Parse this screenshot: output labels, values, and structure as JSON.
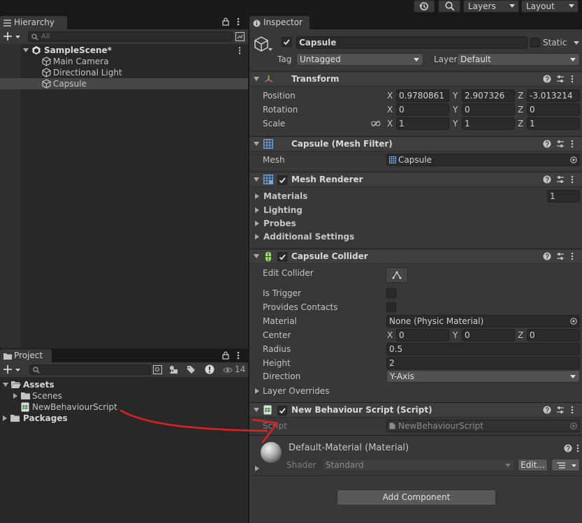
{
  "toolbar": {
    "layers_label": "Layers",
    "layout_label": "Layout"
  },
  "hierarchy": {
    "tab_label": "Hierarchy",
    "search_placeholder": "All",
    "scene_name": "SampleScene*",
    "items": [
      {
        "label": "Main Camera"
      },
      {
        "label": "Directional Light"
      },
      {
        "label": "Capsule"
      }
    ]
  },
  "project": {
    "tab_label": "Project",
    "hidden_count": "14",
    "tree": {
      "assets": "Assets",
      "scenes": "Scenes",
      "script": "NewBehaviourScript",
      "packages": "Packages"
    }
  },
  "inspector": {
    "tab_label": "Inspector",
    "object_name": "Capsule",
    "static_label": "Static",
    "tag_label": "Tag",
    "tag_value": "Untagged",
    "layer_label": "Layer",
    "layer_value": "Default",
    "transform": {
      "title": "Transform",
      "position_label": "Position",
      "rotation_label": "Rotation",
      "scale_label": "Scale",
      "axis_x": "X",
      "axis_y": "Y",
      "axis_z": "Z",
      "position": {
        "x": "0.9780861",
        "y": "2.907326",
        "z": "-3.013214"
      },
      "rotation": {
        "x": "0",
        "y": "0",
        "z": "0"
      },
      "scale": {
        "x": "1",
        "y": "1",
        "z": "1"
      }
    },
    "mesh_filter": {
      "title": "Capsule (Mesh Filter)",
      "mesh_label": "Mesh",
      "mesh_value": "Capsule"
    },
    "mesh_renderer": {
      "title": "Mesh Renderer",
      "materials_label": "Materials",
      "materials_count": "1",
      "lighting_label": "Lighting",
      "probes_label": "Probes",
      "additional_label": "Additional Settings"
    },
    "capsule_collider": {
      "title": "Capsule Collider",
      "edit_collider_label": "Edit Collider",
      "is_trigger_label": "Is Trigger",
      "provides_contacts_label": "Provides Contacts",
      "material_label": "Material",
      "material_value": "None (Physic Material)",
      "center_label": "Center",
      "center": {
        "x": "0",
        "y": "0",
        "z": "0"
      },
      "radius_label": "Radius",
      "radius_value": "0.5",
      "height_label": "Height",
      "height_value": "2",
      "direction_label": "Direction",
      "direction_value": "Y-Axis",
      "layer_overrides_label": "Layer Overrides"
    },
    "script": {
      "title": "New Behaviour Script (Script)",
      "script_label": "Script",
      "script_value": "NewBehaviourScript"
    },
    "material": {
      "title": "Default-Material (Material)",
      "shader_label": "Shader",
      "shader_value": "Standard",
      "edit_label": "Edit..."
    },
    "add_component_label": "Add Component"
  },
  "annotation": {
    "color": "#e02020"
  }
}
